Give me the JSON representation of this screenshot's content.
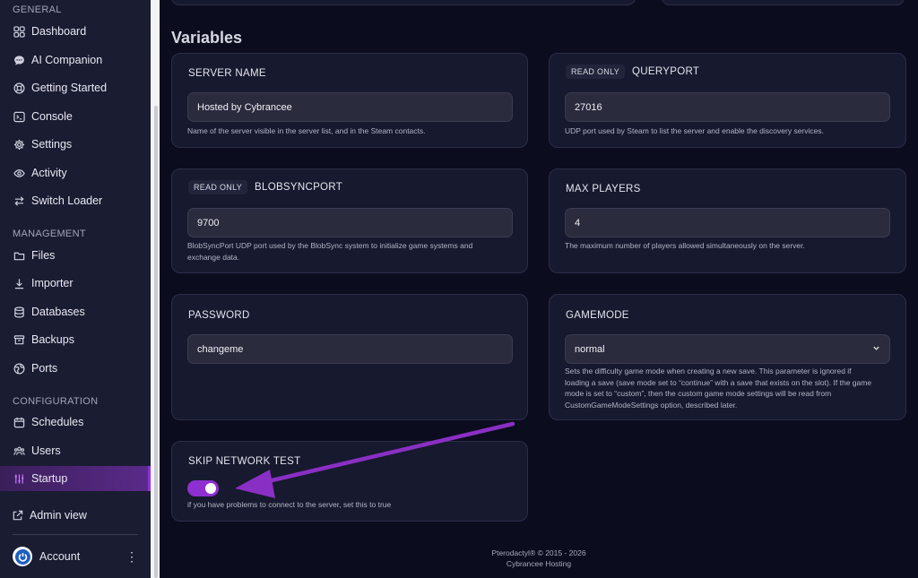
{
  "sidebar": {
    "sections": {
      "general": "GENERAL",
      "management": "MANAGEMENT",
      "configuration": "CONFIGURATION"
    },
    "items": [
      {
        "label": "Dashboard",
        "icon": "grid-icon"
      },
      {
        "label": "AI Companion",
        "icon": "chat-icon"
      },
      {
        "label": "Getting Started",
        "icon": "lifebuoy-icon"
      },
      {
        "label": "Console",
        "icon": "terminal-icon"
      },
      {
        "label": "Settings",
        "icon": "gear-icon"
      },
      {
        "label": "Activity",
        "icon": "eye-icon"
      },
      {
        "label": "Switch Loader",
        "icon": "swap-icon"
      },
      {
        "label": "Files",
        "icon": "folder-icon"
      },
      {
        "label": "Importer",
        "icon": "download-icon"
      },
      {
        "label": "Databases",
        "icon": "database-icon"
      },
      {
        "label": "Backups",
        "icon": "archive-icon"
      },
      {
        "label": "Ports",
        "icon": "globe-icon"
      },
      {
        "label": "Schedules",
        "icon": "calendar-icon"
      },
      {
        "label": "Users",
        "icon": "users-icon"
      },
      {
        "label": "Startup",
        "icon": "sliders-icon",
        "active": true
      },
      {
        "label": "Admin view",
        "icon": "external-link-icon"
      }
    ],
    "account": {
      "label": "Account",
      "icon": "power-icon",
      "menu_icon": "kebab-icon"
    }
  },
  "main": {
    "heading": "Variables",
    "read_only_badge": "READ ONLY",
    "variables": [
      {
        "title": "SERVER NAME",
        "value": "Hosted by Cybrancee",
        "description": "Name of the server visible in the server list, and in the Steam contacts."
      },
      {
        "title": "QUERYPORT",
        "read_only": true,
        "value": "27016",
        "description": "UDP port used by Steam to list the server and enable the discovery services."
      },
      {
        "title": "BLOBSYNCPORT",
        "read_only": true,
        "value": "9700",
        "description_line1": "BlobSyncPort UDP port used by the BlobSync system to initialize game systems and",
        "description_line2": "exchange data."
      },
      {
        "title": "MAX PLAYERS",
        "value": "4",
        "description": "The maximum number of players allowed simultaneously on the server."
      },
      {
        "title": "PASSWORD",
        "value": "changeme",
        "description": ""
      },
      {
        "title": "GAMEMODE",
        "value": "normal",
        "type": "select",
        "description_lines": [
          "Sets the difficulty game mode when creating a new save. This parameter is ignored if",
          "loading a save (save mode set to “continue” with a save that exists on the slot). If the game",
          "mode is set to “custom”, then the custom game mode settings will be read from",
          "CustomGameModeSettings option, described later."
        ]
      },
      {
        "title": "SKIP NETWORK TEST",
        "type": "toggle",
        "enabled": true,
        "description": "if you have problems to connect to the server, set this to true"
      }
    ]
  },
  "footer": {
    "line1": "Pterodactyl® © 2015 - 2026",
    "line2": "Cybrancee Hosting"
  },
  "colors": {
    "accent": "#8e2fd0",
    "arrow": "#8a2fc4",
    "background": "#0b0c1e"
  }
}
